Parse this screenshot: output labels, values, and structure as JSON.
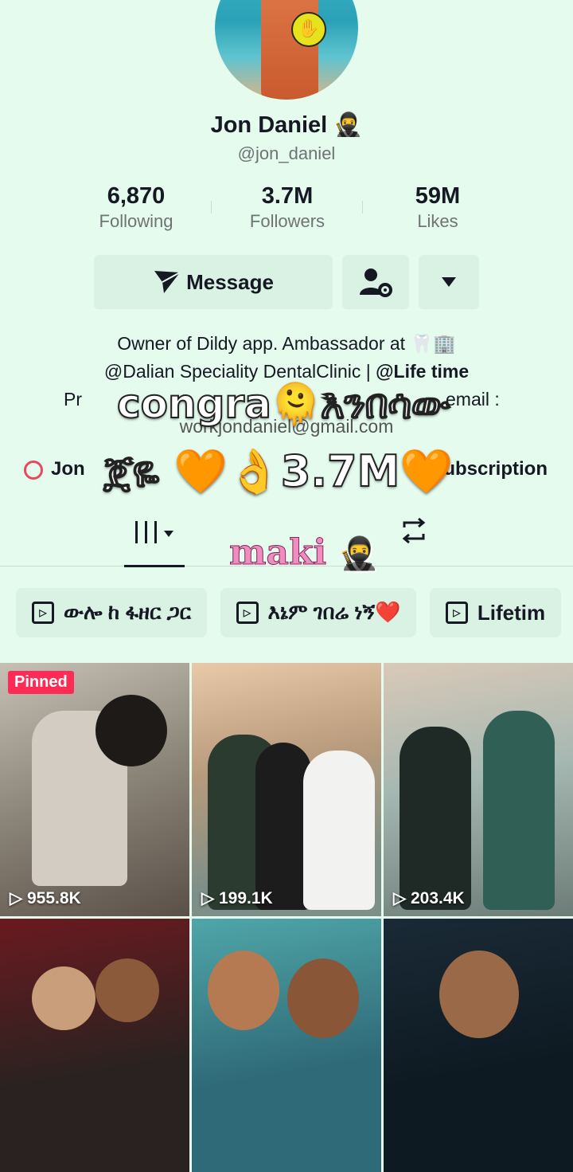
{
  "profile": {
    "name": "Jon Daniel",
    "name_emoji": "🥷",
    "handle": "@jon_daniel"
  },
  "stats": [
    {
      "value": "6,870",
      "label": "Following"
    },
    {
      "value": "3.7M",
      "label": "Followers"
    },
    {
      "value": "59M",
      "label": "Likes"
    }
  ],
  "actions": {
    "message_label": "Message",
    "message_icon": "send-icon",
    "add_friend_icon": "add-friend-gear-icon",
    "more_icon": "caret-down-icon"
  },
  "bio": {
    "line1": "Owner of Dildy app.   Ambassador at 🦷🏢",
    "line2_a": "@Dalian Speciality DentalClinic  | ",
    "line2_b": "@Life time",
    "line3_left": "Pr",
    "line3_right": "email :",
    "line4": "workjondaniel@gmail.com",
    "link_left": "Jon",
    "link_right": "ubscription"
  },
  "overlay": {
    "line1": "congra🫠እንበሳው",
    "line2": "ጀዬ 🧡👌3.7M🧡",
    "sticker": "maki",
    "sticker_emoji": "🥷"
  },
  "tabs": {
    "grid_icon": "grid-videos-icon",
    "repost_icon": "repost-icon"
  },
  "playlists": [
    {
      "label": "ውሎ ከ ፋዘር ጋር"
    },
    {
      "label": "እኔም ገበሬ ነኝ❤️"
    },
    {
      "label": "Lifetim"
    }
  ],
  "videos": [
    {
      "views": "955.8K",
      "pinned": "Pinned"
    },
    {
      "views": "199.1K"
    },
    {
      "views": "203.4K"
    },
    {
      "views": ""
    },
    {
      "views": ""
    },
    {
      "views": ""
    }
  ]
}
